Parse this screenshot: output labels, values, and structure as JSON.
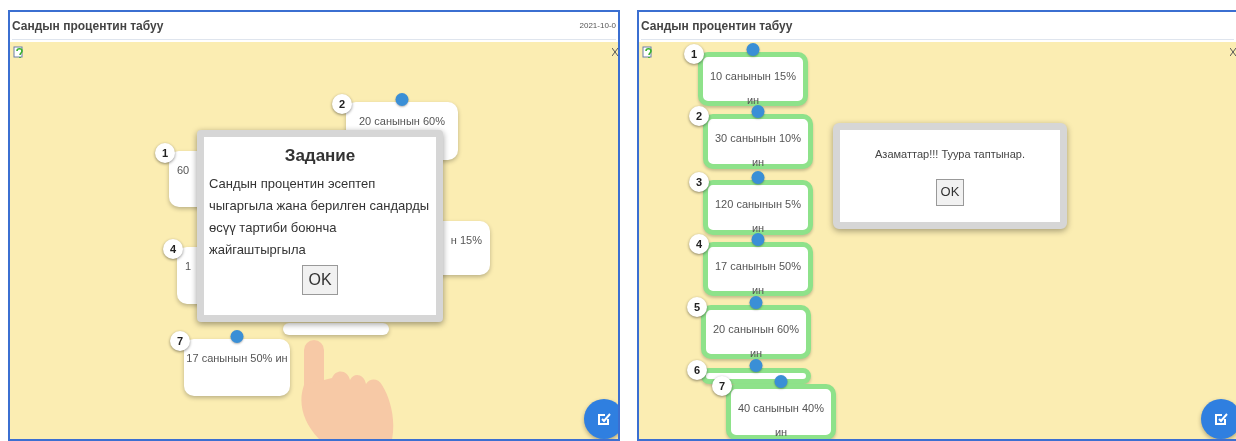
{
  "windows": [
    {
      "title": "Сандын процентин табуу",
      "date": "2021-10-0",
      "cards": [
        {
          "number": "2",
          "text": "20 санынын 60%",
          "kind": "plain"
        },
        {
          "number": "1",
          "text": "60",
          "kind": "plain"
        },
        {
          "text": "н 15%",
          "kind": "plain"
        },
        {
          "number": "4",
          "text": "1",
          "kind": "plain"
        },
        {
          "kind": "plain"
        },
        {
          "number": "7",
          "text": "17 санынын 50% ин",
          "kind": "plain"
        }
      ],
      "dialog": {
        "title": "Задание",
        "text": "Сандын процентин эсептеп чыгаргыла жана берилген сандарды өсүү тартиби боюнча жайгаштыргыла",
        "button": "OK"
      }
    },
    {
      "title": "Сандын процентин табуу",
      "cards": [
        {
          "number": "1",
          "text": "10 санынын 15% ин",
          "kind": "matched"
        },
        {
          "number": "2",
          "text": "30 санынын 10% ин",
          "kind": "matched"
        },
        {
          "number": "3",
          "text": "120 санынын 5% ин",
          "kind": "matched"
        },
        {
          "number": "4",
          "text": "17 санынын 50% ин",
          "kind": "matched"
        },
        {
          "number": "5",
          "text": "20 санынын 60% ин",
          "kind": "matched"
        },
        {
          "number": "6",
          "kind": "matched"
        },
        {
          "number": "7",
          "text": "40 санынын 40% ин",
          "kind": "matched"
        }
      ],
      "dialog": {
        "text": "Азаматтар!!! Туура таптынар.",
        "button": "OK"
      }
    }
  ]
}
